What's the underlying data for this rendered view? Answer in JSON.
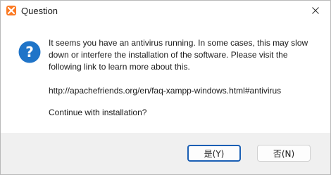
{
  "window": {
    "title": "Question",
    "icons": {
      "app": "xampp-logo-icon",
      "close": "close-icon",
      "message": "question-icon"
    }
  },
  "message": {
    "lines": [
      "It seems you have an antivirus running. In some cases, this may slow",
      "down or interfere the installation of the software. Please visit the",
      "following link to learn more about this."
    ],
    "link": "http://apachefriends.org/en/faq-xampp-windows.html#antivirus",
    "prompt": "Continue with installation?"
  },
  "buttons": {
    "yes": "是(Y)",
    "no": "否(N)"
  },
  "colors": {
    "accent": "#1a5fb4",
    "question_icon": "#1f74c8",
    "footer_bg": "#f0f0f0"
  }
}
